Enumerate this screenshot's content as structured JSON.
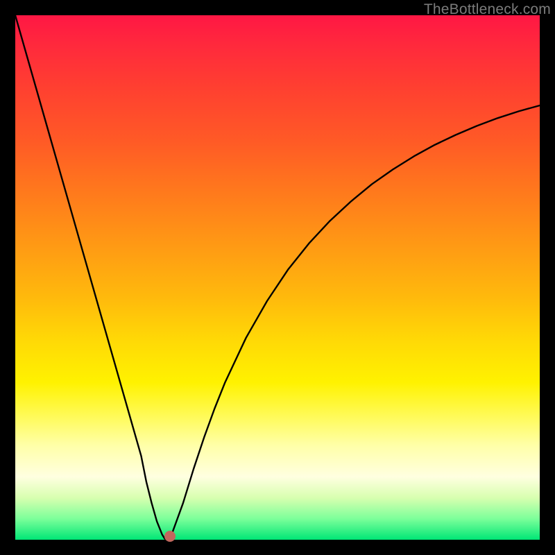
{
  "watermark": "TheBottleneck.com",
  "colors": {
    "frame": "#000000",
    "curve": "#000000",
    "marker": "#c1675d"
  },
  "chart_data": {
    "type": "line",
    "title": "",
    "xlabel": "",
    "ylabel": "",
    "xlim": [
      0,
      100
    ],
    "ylim": [
      0,
      100
    ],
    "x": [
      0,
      2,
      4,
      6,
      8,
      10,
      12,
      14,
      16,
      18,
      20,
      22,
      24,
      25,
      26,
      27,
      28,
      28.5,
      29,
      29.5,
      30,
      32,
      34,
      36,
      38,
      40,
      44,
      48,
      52,
      56,
      60,
      64,
      68,
      72,
      76,
      80,
      84,
      88,
      92,
      96,
      100
    ],
    "values": [
      100,
      93,
      86,
      79,
      72,
      65,
      58,
      51,
      44,
      37,
      30,
      23,
      16,
      11,
      7,
      3.5,
      1,
      0.2,
      0,
      0.2,
      1.5,
      7,
      13.5,
      19.5,
      25,
      30,
      38.5,
      45.5,
      51.5,
      56.5,
      60.8,
      64.5,
      67.8,
      70.6,
      73.1,
      75.3,
      77.2,
      78.9,
      80.4,
      81.7,
      82.8
    ],
    "marker": {
      "x": 29.5,
      "y": 0.6
    },
    "background_gradient": {
      "top": "#ff1744",
      "mid": "#fff200",
      "bottom": "#00e676"
    }
  }
}
